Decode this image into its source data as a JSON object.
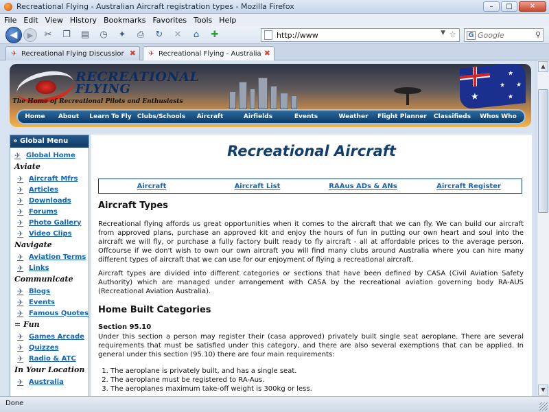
{
  "window": {
    "title": "Recreational Flying - Australian Aircraft registration types - Mozilla Firefox",
    "min_label": "–",
    "max_label": "□",
    "close_label": "✕"
  },
  "menubar": [
    "File",
    "Edit",
    "View",
    "History",
    "Bookmarks",
    "Favorites",
    "Tools",
    "Help"
  ],
  "toolbar": {
    "url": "http://www",
    "search_placeholder": "Google",
    "search_engine_letter": "G"
  },
  "tabs": [
    {
      "label": "Recreational Flying Discussion Foru...",
      "active": false
    },
    {
      "label": "Recreational Flying - Australian Ai...",
      "active": true
    }
  ],
  "banner": {
    "site_name_line1": "RECREATIONAL",
    "site_name_line2": "FLYING",
    "tagline": "The Home of Recreational Pilots and Enthusiasts"
  },
  "nav": [
    "Home",
    "About",
    "Learn To Fly",
    "Clubs/Schools",
    "Aircraft",
    "Airfields",
    "Events",
    "Weather",
    "Flight Planner",
    "Classifieds",
    "Whos Who"
  ],
  "sidebar": {
    "header": "» Global Menu",
    "top_link": "Global Home",
    "sections": [
      {
        "title": "Aviate",
        "links": [
          "Aircraft Mfrs",
          "Articles",
          "Downloads",
          "Forums",
          "Photo Gallery",
          "Video Clips"
        ]
      },
      {
        "title": "Navigate",
        "links": [
          "Aviation Terms",
          "Links"
        ]
      },
      {
        "title": "Communicate",
        "links": [
          "Blogs",
          "Events",
          "Famous Quotes"
        ]
      },
      {
        "title": "= Fun",
        "links": [
          "Games Arcade",
          "Quizzes",
          "Radio & ATC"
        ]
      },
      {
        "title": "In Your Location",
        "links": [
          "Australia"
        ]
      }
    ]
  },
  "content": {
    "page_title": "Recreational Aircraft",
    "sub_nav": [
      "Aircraft",
      "Aircraft List",
      "RAAus ADs & ANs",
      "Aircraft Register"
    ],
    "h_aircraft_types": "Aircraft Types",
    "p1": "Recreational flying affords us great opportunities when it comes to the aircraft that we can fly. We can build our aircraft from approved plans, purchase an approved kit and enjoy the hours of fun in putting our own heart and soul into the aircraft we will fly, or purchase a fully factory built ready to fly aircraft - all at affordable prices to the average person. Offcourse if we don't wish to own our own aircraft you will find many clubs around Australia where you can hire many different types of aircraft that we can use for our enjoyment of flying a recreational aircraft.",
    "p2": "Aircraft types are divided into different categories or sections that have been defined by CASA (Civil Aviation Safety Authority) which are managed under arrangement with CASA by the recreational aviation governing body RA-AUS (Recreational Aviation Australia).",
    "h_home_built": "Home Built Categories",
    "h_section": "Section 95.10",
    "p3": "Under this section a person may register their (casa approved) privately built single seat aeroplane. There are several requirements that must be satisfied under this category, and there are also several exemptions that can be applied. In general under this section (95.10) there are four main requirements:",
    "requirements": [
      "The aeroplane is privately built, and has a single seat.",
      "The aeroplane must be registered to RA-Aus.",
      "The aeroplanes maximum take-off weight is 300kg or less."
    ]
  },
  "status": "Done"
}
